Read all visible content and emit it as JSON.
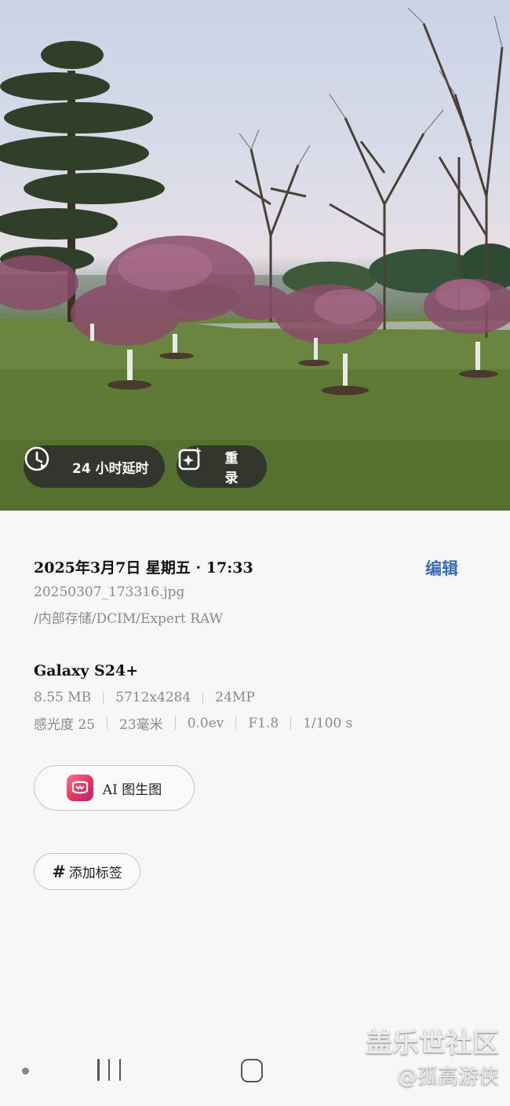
{
  "photo": {
    "timer_label": "24 小时延时",
    "retake_label": "重录"
  },
  "details": {
    "datetime": "2025年3月7日 星期五 · 17:33",
    "edit_label": "编辑",
    "filename": "20250307_173316.jpg",
    "path": "/内部存储/DCIM/Expert RAW",
    "device": "Galaxy S24+",
    "file_meta": [
      "8.55 MB",
      "5712x4284",
      "24MP"
    ],
    "camera_meta": [
      "感光度 25",
      "23毫米",
      "0.0ev",
      "F1.8",
      "1/100 s"
    ]
  },
  "actions": {
    "ai_label": "AI 图生图",
    "tag_hash": "#",
    "tag_label": "添加标签"
  },
  "watermark": {
    "site": "盖乐世社区",
    "author": "@孤高游侠"
  },
  "colors": {
    "accent": "#3b6fb5",
    "pill_bg": "#2d2d2d",
    "secondary_text": "#8a8a8a"
  }
}
